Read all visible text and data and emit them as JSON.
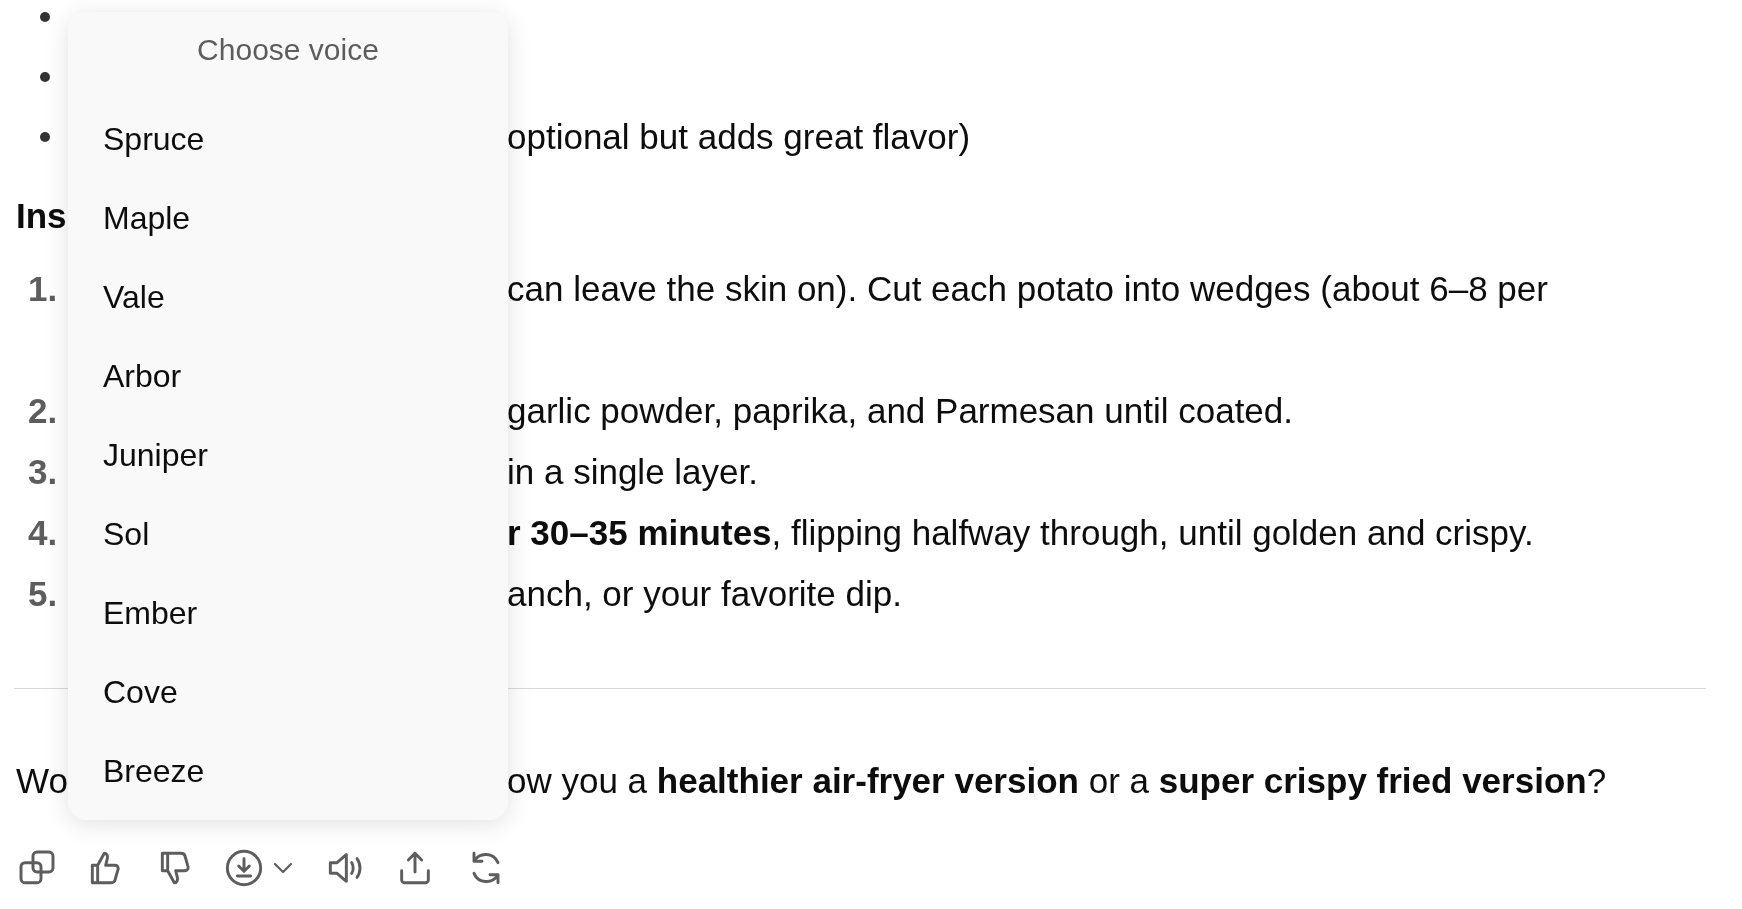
{
  "document": {
    "bullets": [
      {
        "kind": "covered"
      },
      {
        "kind": "covered"
      },
      {
        "kind": "text",
        "text": "optional but adds great flavor)"
      }
    ],
    "heading": "Ins",
    "steps": [
      {
        "number": "1.",
        "text": "can leave the skin on). Cut each potato into wedges (about 6–8 per"
      },
      {
        "number": "2.",
        "text": "garlic powder, paprika, and Parmesan until coated."
      },
      {
        "number": "3.",
        "text": "in a single layer."
      },
      {
        "number": "4.",
        "text": "**r 30–35 minutes**, flipping halfway through, until golden and crispy."
      },
      {
        "number": "5.",
        "text": "anch, or your favorite dip."
      }
    ],
    "closing": {
      "lead": "Wo",
      "text": "ow you a **healthier air-fryer version** or a **super crispy fried version**?"
    }
  },
  "voice_menu": {
    "title": "Choose voice",
    "voices": [
      "Spruce",
      "Maple",
      "Vale",
      "Arbor",
      "Juniper",
      "Sol",
      "Ember",
      "Cove",
      "Breeze"
    ]
  }
}
